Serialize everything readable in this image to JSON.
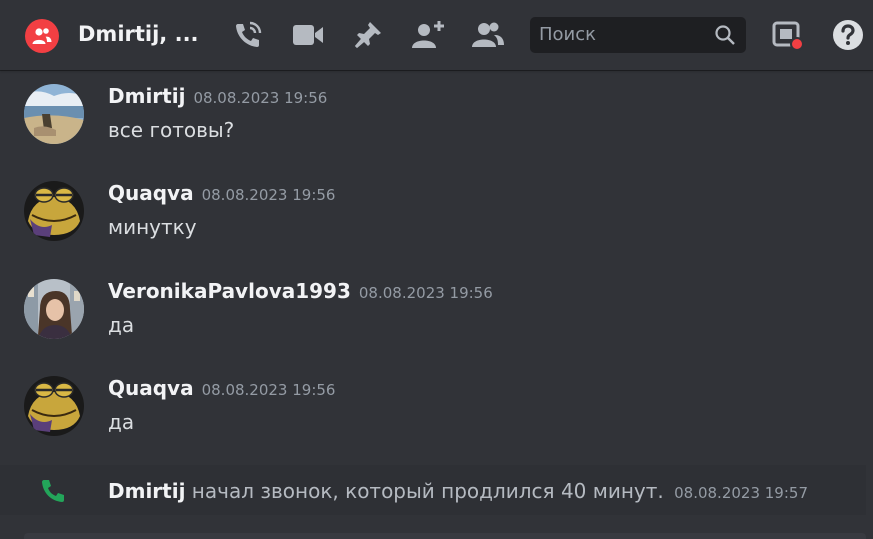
{
  "header": {
    "title": "Dmirtij, ...",
    "search_placeholder": "Поиск",
    "channel_icon": "group-dm-icon",
    "accent_color": "#f23f43",
    "icons": [
      "start-call-icon",
      "start-video-icon",
      "pinned-messages-icon",
      "add-friends-icon",
      "member-list-icon",
      "search-icon",
      "inbox-icon",
      "help-icon"
    ]
  },
  "messages": [
    {
      "author": "Dmirtij",
      "timestamp": "08.08.2023 19:56",
      "text": "все готовы?"
    },
    {
      "author": "Quaqva",
      "timestamp": "08.08.2023 19:56",
      "text": "минутку"
    },
    {
      "author": "VeronikaPavlova1993",
      "timestamp": "08.08.2023 19:56",
      "text": "да"
    },
    {
      "author": "Quaqva",
      "timestamp": "08.08.2023 19:56",
      "text": "да"
    }
  ],
  "system_message": {
    "icon": "phone-icon",
    "author": "Dmirtij",
    "text": "начал звонок, который продлился 40 минут.",
    "timestamp": "08.08.2023 19:57",
    "icon_color": "#23a55a"
  }
}
